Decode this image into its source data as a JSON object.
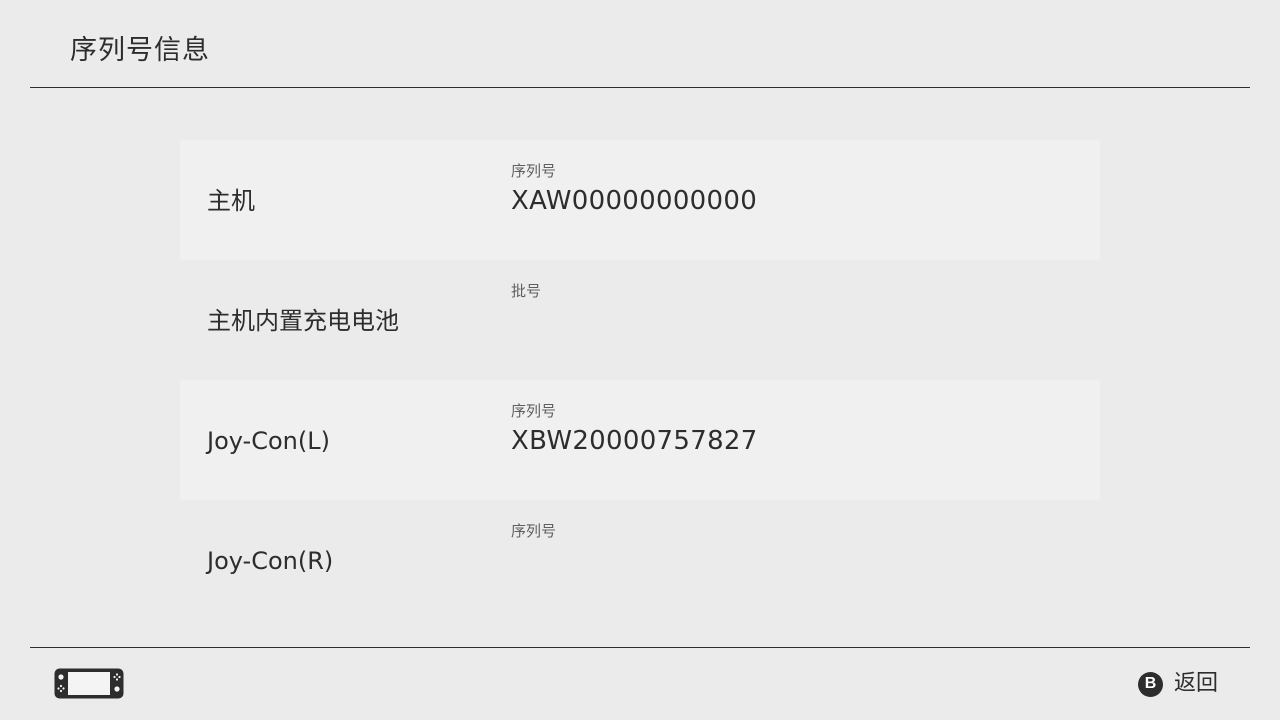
{
  "header": {
    "title": "序列号信息"
  },
  "rows": [
    {
      "label": "主机",
      "caption": "序列号",
      "value": "XAW00000000000"
    },
    {
      "label": "主机内置充电电池",
      "caption": "批号",
      "value": ""
    },
    {
      "label": "Joy-Con(L)",
      "caption": "序列号",
      "value": "XBW20000757827"
    },
    {
      "label": "Joy-Con(R)",
      "caption": "序列号",
      "value": ""
    }
  ],
  "footer": {
    "device_icon": "handheld-console-icon",
    "back_button_icon": "B",
    "back_label": "返回"
  },
  "colors": {
    "background": "#ebebeb",
    "row_highlight": "#f0f0f0",
    "text": "#2d2d2d",
    "caption": "#5f5f5f"
  }
}
